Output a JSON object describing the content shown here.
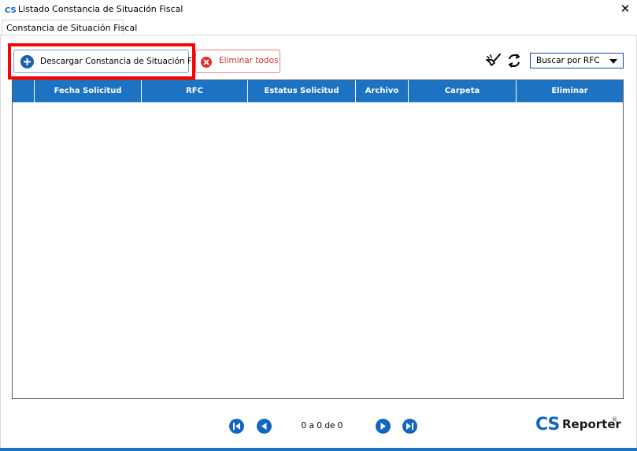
{
  "window": {
    "title": "Listado Constancia de Situación Fiscal",
    "close_glyph": "✕"
  },
  "tabs": [
    {
      "label": "Constancia de Situación Fiscal"
    }
  ],
  "toolbar": {
    "download_label": "Descargar Constancia de Situación Fiscal",
    "delete_all_label": "Eliminar todos",
    "search_select_value": "Buscar por RFC"
  },
  "table": {
    "columns": [
      "",
      "Fecha Solicitud",
      "RFC",
      "Estatus Solicitud",
      "Archivo",
      "Carpeta",
      "Eliminar"
    ],
    "rows": []
  },
  "pager": {
    "text": "0 a 0 de 0"
  },
  "logo": {
    "cs": "CS",
    "name": "Reporter",
    "mark": "®"
  },
  "colors": {
    "header_blue": "#1c73c4",
    "highlight_red": "#ff0000",
    "delete_red": "#d9312e",
    "pager_blue": "#1266c1"
  },
  "icons": {
    "download": "plus-circle-icon",
    "delete_all": "x-circle-icon",
    "clean": "broom-icon",
    "refresh": "refresh-icon",
    "first": "first-page-icon",
    "prev": "previous-page-icon",
    "next": "next-page-icon",
    "last": "last-page-icon"
  }
}
